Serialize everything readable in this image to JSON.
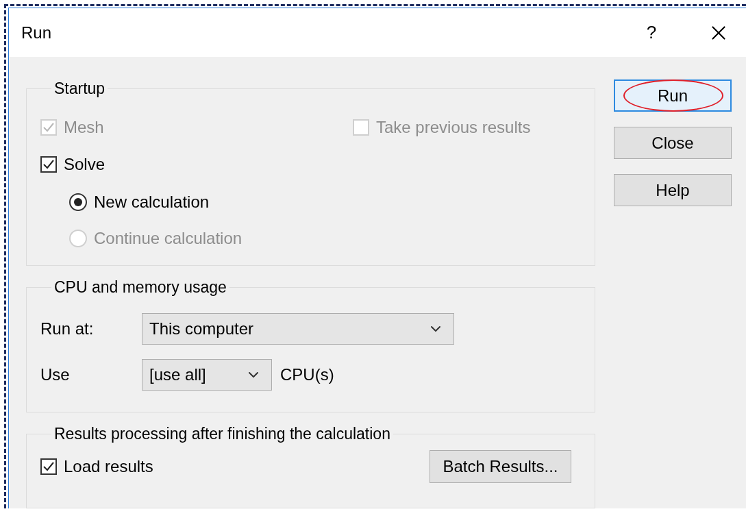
{
  "window": {
    "title": "Run",
    "help_glyph": "?"
  },
  "startup": {
    "label": "Startup",
    "mesh": {
      "label": "Mesh",
      "checked": true,
      "disabled": true
    },
    "take_previous": {
      "label": "Take previous results",
      "checked": false,
      "disabled": true
    },
    "solve": {
      "label": "Solve",
      "checked": true,
      "disabled": false
    },
    "calculation": [
      {
        "label": "New calculation",
        "selected": true,
        "disabled": false
      },
      {
        "label": "Continue calculation",
        "selected": false,
        "disabled": true
      }
    ]
  },
  "cpu": {
    "label": "CPU and memory usage",
    "run_at_label": "Run at:",
    "run_at_value": "This computer",
    "use_label": "Use",
    "use_value": "[use all]",
    "use_suffix": "CPU(s)"
  },
  "results": {
    "label": "Results processing after finishing the calculation",
    "load_results": {
      "label": "Load results",
      "checked": true,
      "disabled": false
    },
    "batch_button": "Batch Results..."
  },
  "buttons": [
    {
      "label": "Run",
      "default": true,
      "annotated": true
    },
    {
      "label": "Close",
      "default": false,
      "annotated": false
    },
    {
      "label": "Help",
      "default": false,
      "annotated": false
    }
  ]
}
